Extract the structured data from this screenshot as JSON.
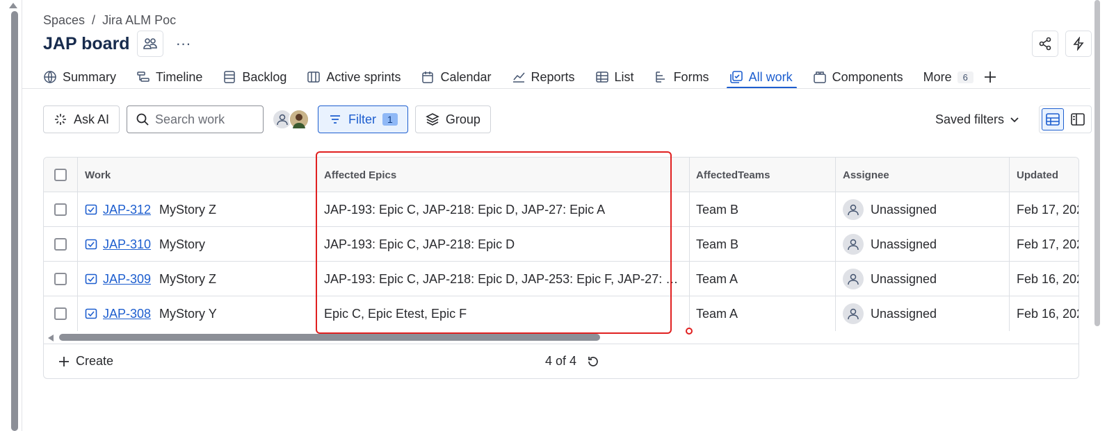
{
  "breadcrumb": {
    "root": "Spaces",
    "separator": "/",
    "project": "Jira ALM Poc"
  },
  "header": {
    "title": "JAP board",
    "more_label": "···"
  },
  "tabs": [
    {
      "label": "Summary",
      "icon": "globe-icon"
    },
    {
      "label": "Timeline",
      "icon": "timeline-icon"
    },
    {
      "label": "Backlog",
      "icon": "backlog-icon"
    },
    {
      "label": "Active sprints",
      "icon": "columns-icon"
    },
    {
      "label": "Calendar",
      "icon": "calendar-icon"
    },
    {
      "label": "Reports",
      "icon": "chart-line-icon"
    },
    {
      "label": "List",
      "icon": "table-icon"
    },
    {
      "label": "Forms",
      "icon": "forms-icon"
    },
    {
      "label": "All work",
      "icon": "all-work-icon",
      "active": true
    },
    {
      "label": "Components",
      "icon": "components-icon"
    },
    {
      "label": "More",
      "badge": "6"
    }
  ],
  "toolbar": {
    "ask_ai": "Ask AI",
    "search_placeholder": "Search work",
    "filter_label": "Filter",
    "filter_count": "1",
    "group_label": "Group",
    "saved_filters": "Saved filters"
  },
  "table": {
    "headers": {
      "work": "Work",
      "affected_epics": "Affected Epics",
      "affected_teams": "AffectedTeams",
      "assignee": "Assignee",
      "updated": "Updated"
    },
    "rows": [
      {
        "key": "JAP-312",
        "summary": "MyStory Z",
        "epics": "JAP-193: Epic C, JAP-218: Epic D, JAP-27: Epic A",
        "team": "Team B",
        "assignee": "Unassigned",
        "updated": "Feb 17, 202"
      },
      {
        "key": "JAP-310",
        "summary": "MyStory",
        "epics": "JAP-193: Epic C, JAP-218: Epic D",
        "team": "Team B",
        "assignee": "Unassigned",
        "updated": "Feb 17, 202"
      },
      {
        "key": "JAP-309",
        "summary": "MyStory Z",
        "epics": "JAP-193: Epic C, JAP-218: Epic D, JAP-253: Epic F, JAP-27: E...",
        "team": "Team A",
        "assignee": "Unassigned",
        "updated": "Feb 16, 202"
      },
      {
        "key": "JAP-308",
        "summary": "MyStory Y",
        "epics": "Epic C, Epic Etest, Epic F",
        "team": "Team A",
        "assignee": "Unassigned",
        "updated": "Feb 16, 202"
      }
    ]
  },
  "footer": {
    "create_label": "Create",
    "count": "4 of 4"
  },
  "colors": {
    "accent": "#1d5ecf",
    "highlight": "#e02020"
  }
}
